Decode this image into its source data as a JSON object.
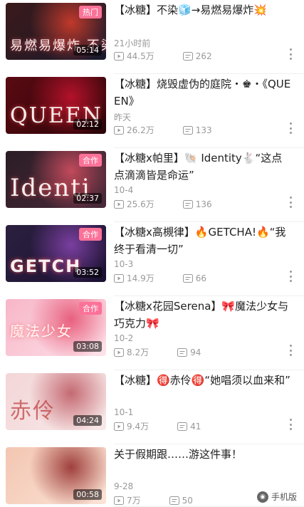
{
  "items": [
    {
      "title": "【冰糖】不染🧊→易燃易爆炸💥",
      "date": "21小时前",
      "views": "44.5万",
      "comments": "262",
      "duration": "05:14",
      "badge": "热门",
      "thumb_text": "易燃易爆炸 不染"
    },
    {
      "title": "【冰糖】烧毁虚伪的庭院・♚・《QUEEN》",
      "date": "昨天",
      "views": "26.2万",
      "comments": "133",
      "duration": "02:12",
      "badge": "",
      "thumb_text": "QUEEN"
    },
    {
      "title": "【冰糖x帕里】🐚 Identity🐇“这点点滴滴皆是命运”",
      "date": "10-4",
      "views": "25.6万",
      "comments": "136",
      "duration": "02:37",
      "badge": "合作",
      "thumb_text": "Identi"
    },
    {
      "title": "【冰糖x高槻律】🔥GETCHA!🔥“我终于看清一切”",
      "date": "10-3",
      "views": "14.9万",
      "comments": "66",
      "duration": "03:52",
      "badge": "合作",
      "thumb_text": "GETCH"
    },
    {
      "title": "【冰糖x花园Serena】🎀魔法少女与巧克力🎀",
      "date": "10-2",
      "views": "8.2万",
      "comments": "94",
      "duration": "03:08",
      "badge": "合作",
      "thumb_text": "魔法少女"
    },
    {
      "title": "【冰糖】🉐赤伶🉐“她唱须以血来和”",
      "date": "10-1",
      "views": "9.4万",
      "comments": "41",
      "duration": "04:24",
      "badge": "",
      "thumb_text": "赤伶"
    },
    {
      "title": "关于假期跟……游这件事！",
      "date": "9-28",
      "views": "7万",
      "comments": "50",
      "duration": "00:58",
      "badge": "",
      "thumb_text": ""
    }
  ],
  "watermark": "手机版",
  "thumb_colors": [
    [
      "#3a1a1a",
      "#c0392b",
      "#1a1a2e"
    ],
    [
      "#5a0a12",
      "#b3122a",
      "#2a0508"
    ],
    [
      "#2b1d26",
      "#c24a5c",
      "#4a2a3a"
    ],
    [
      "#2c2040",
      "#7a3fa0",
      "#1a1030"
    ],
    [
      "#f7b6c8",
      "#e8607f",
      "#fde3ea"
    ],
    [
      "#f3d6d8",
      "#c46a72",
      "#f8e8e8"
    ],
    [
      "#f3c6b2",
      "#a0403c",
      "#fbe3d6"
    ]
  ]
}
